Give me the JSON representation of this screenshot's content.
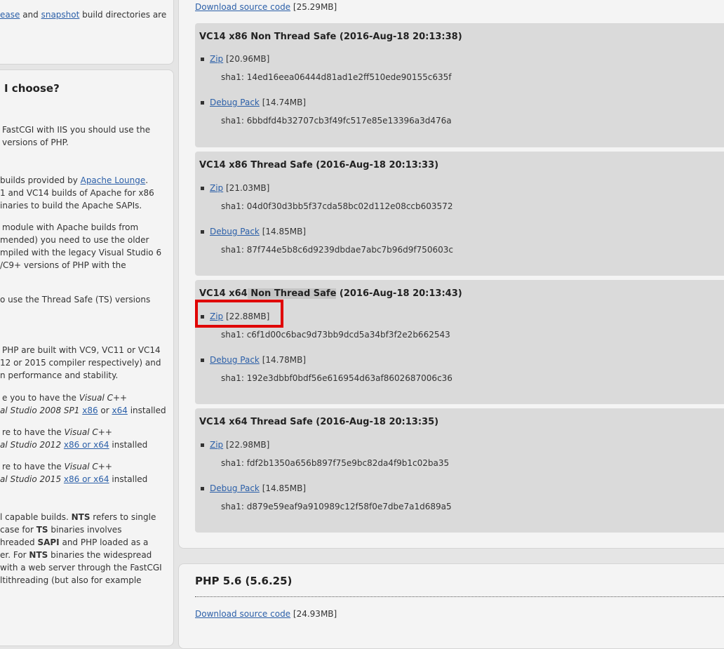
{
  "left": {
    "top_line": {
      "link1": "ease",
      "text1": " and ",
      "link2": "snapshot",
      "text2": " build directories are"
    },
    "heading": "I choose?",
    "paragraphs": [
      {
        "lines": [
          "FastCGI with IIS you should use the",
          "versions of PHP."
        ]
      },
      {
        "lines": [
          "builds provided by ",
          "1 and VC14 builds of Apache for x86",
          "inaries to build the Apache SAPIs."
        ],
        "link": "Apache Lounge",
        "tail": "."
      },
      {
        "lines": [
          "module with Apache builds from",
          "mended) you need to use the older",
          "mpiled with the legacy Visual Studio 6",
          "/C9+ versions of PHP with the"
        ]
      },
      {
        "lines": [
          "o use the Thread Safe (TS) versions"
        ]
      },
      {
        "lines": [
          "PHP are built with VC9, VC11 or VC14",
          "12 or 2015 compiler respectively) and",
          "n performance and stability."
        ]
      }
    ],
    "req1": {
      "l1_pre": "e you to have the ",
      "l1_em": "Visual C++",
      "l2_em": "al Studio 2008 SP1",
      "l2_link1": "x86",
      "l2_or": " or ",
      "l2_link2": "x64",
      "l2_tail": " installed"
    },
    "req2": {
      "l1_pre": "re to have the ",
      "l1_em": "Visual C++",
      "l2_em": "al Studio 2012",
      "l2_link": "x86 or x64",
      "l2_tail": " installed"
    },
    "req3": {
      "l1_pre": "re to have the ",
      "l1_em": "Visual C++",
      "l2_em": "al Studio 2015",
      "l2_link": "x86 or x64",
      "l2_tail": " installed"
    },
    "nts": {
      "l1_a": "l capable builds. ",
      "l1_b": "NTS",
      "l1_c": " refers to single",
      "l2_a": "case for ",
      "l2_b": "TS",
      "l2_c": " binaries involves",
      "l3_a": "hreaded ",
      "l3_b": "SAPI",
      "l3_c": " and PHP loaded as a",
      "l4_a": "er. For ",
      "l4_b": "NTS",
      "l4_c": " binaries the widespread",
      "l5": "with a web server through the FastCGI",
      "l6": "ltithreading (but also for example"
    }
  },
  "right": {
    "top_download": {
      "label": "Download source code",
      "size": "[25.29MB]"
    },
    "builds": [
      {
        "title": "VC14 x86 Non Thread Safe (2016-Aug-18 20:13:38)",
        "zip_label": "Zip",
        "zip_size": "[20.96MB]",
        "zip_sha": "sha1: 14ed16eea06444d81ad1e2ff510ede90155c635f",
        "debug_label": "Debug Pack",
        "debug_size": "[14.74MB]",
        "debug_sha": "sha1: 6bbdfd4b32707cb3f49fc517e85e13396a3d476a"
      },
      {
        "title": "VC14 x86 Thread Safe (2016-Aug-18 20:13:33)",
        "zip_label": "Zip",
        "zip_size": "[21.03MB]",
        "zip_sha": "sha1: 04d0f30d3bb5f37cda58bc02d112e08ccb603572",
        "debug_label": "Debug Pack",
        "debug_size": "[14.85MB]",
        "debug_sha": "sha1: 87f744e5b8c6d9239dbdae7abc7b96d9f750603c"
      },
      {
        "title_a": "VC14 x64",
        "title_b": " Non Thread Safe",
        "title_c": " (2016-Aug-18 20:13:43)",
        "zip_label": "Zip",
        "zip_size": "[22.88MB]",
        "zip_sha": "sha1: c6f1d00c6bac9d73bb9dcd5a34bf3f2e2b662543",
        "debug_label": "Debug Pack",
        "debug_size": "[14.78MB]",
        "debug_sha": "sha1: 192e3dbbf0bdf56e616954d63af8602687006c36"
      },
      {
        "title": "VC14 x64 Thread Safe (2016-Aug-18 20:13:35)",
        "zip_label": "Zip",
        "zip_size": "[22.98MB]",
        "zip_sha": "sha1: fdf2b1350a656b897f75e9bc82da4f9b1c02ba35",
        "debug_label": "Debug Pack",
        "debug_size": "[14.85MB]",
        "debug_sha": "sha1: d879e59eaf9a910989c12f58f0e7dbe7a1d689a5"
      }
    ],
    "next_version": {
      "title": "PHP 5.6 (5.6.25)",
      "download_label": "Download source code",
      "download_size": "[24.93MB]"
    }
  }
}
